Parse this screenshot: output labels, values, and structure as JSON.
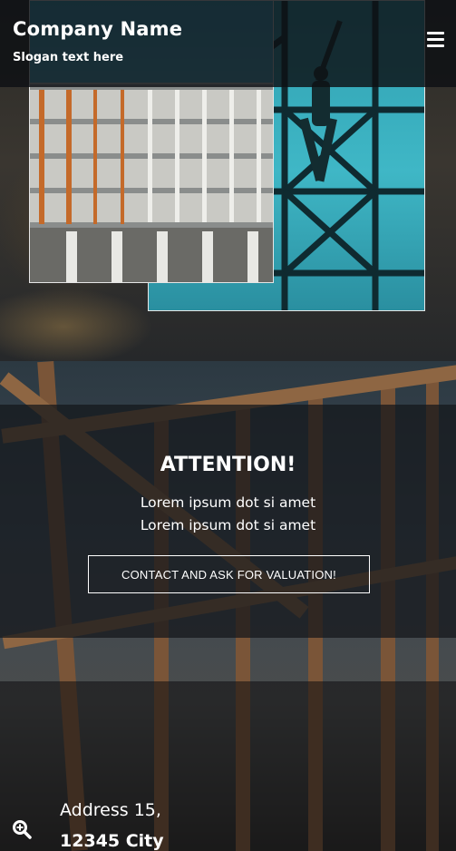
{
  "header": {
    "company_name": "Company Name",
    "slogan": "Slogan text here",
    "menu_icon": "hamburger-menu-icon"
  },
  "hero": {
    "image_left": "building-under-construction-photo",
    "image_right": "worker-on-scaffolding-photo"
  },
  "attention": {
    "title": "ATTENTION!",
    "lines": [
      "Lorem ipsum dot si amet",
      "Lorem ipsum dot si amet"
    ],
    "cta_label": "CONTACT AND ASK FOR VALUATION!"
  },
  "contact": {
    "map_icon": "zoom-search-icon",
    "address_line1": "Address 15,",
    "address_line2": "12345 City"
  },
  "colors": {
    "header_bg": "#0e1013",
    "text": "#ffffff",
    "sky_cyan": "#3fb7c6"
  }
}
